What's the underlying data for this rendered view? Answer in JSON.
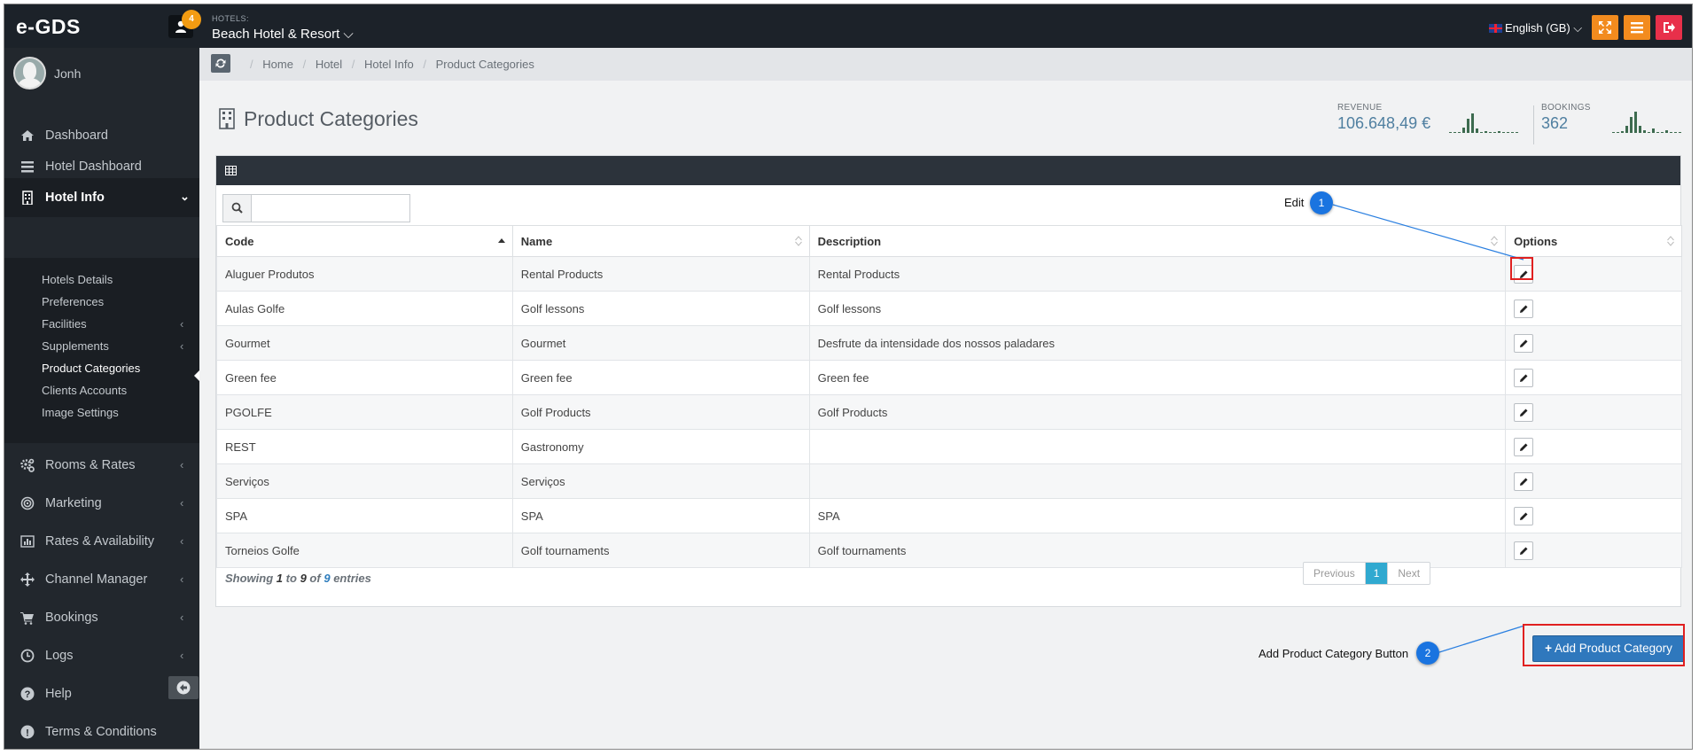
{
  "topbar": {
    "logo": "e-GDS",
    "notification_count": "4",
    "hotel_caption": "HOTELS:",
    "hotel_name": "Beach Hotel & Resort ⌵",
    "language": "English (GB) ⌵"
  },
  "sidebar": {
    "username": "Jonh",
    "items": [
      {
        "label": "Dashboard",
        "icon": "home-icon"
      },
      {
        "label": "Hotel Dashboard",
        "icon": "tasks-icon"
      },
      {
        "label": "Hotel Info",
        "icon": "building-icon"
      },
      {
        "label": "Rooms & Rates",
        "icon": "cogs-icon"
      },
      {
        "label": "Marketing",
        "icon": "bullseye-icon"
      },
      {
        "label": "Rates & Availability",
        "icon": "bar-chart-icon"
      },
      {
        "label": "Channel Manager",
        "icon": "arrows-icon"
      },
      {
        "label": "Bookings",
        "icon": "cart-icon"
      },
      {
        "label": "Logs",
        "icon": "clock-icon"
      },
      {
        "label": "Help",
        "icon": "question-icon"
      },
      {
        "label": "Terms & Conditions",
        "icon": "exclamation-icon"
      }
    ],
    "submenu": [
      {
        "label": "Hotels Details"
      },
      {
        "label": "Preferences"
      },
      {
        "label": "Facilities"
      },
      {
        "label": "Supplements"
      },
      {
        "label": "Product Categories"
      },
      {
        "label": "Clients Accounts"
      },
      {
        "label": "Image Settings"
      }
    ]
  },
  "breadcrumb": [
    "Home",
    "Hotel",
    "Hotel Info",
    "Product Categories"
  ],
  "page": {
    "title": "Product Categories"
  },
  "stats": {
    "revenue_caption": "REVENUE",
    "revenue_value": "106.648,49 €",
    "bookings_caption": "BOOKINGS",
    "bookings_value": "362"
  },
  "table": {
    "search_value": "",
    "columns": [
      "Code",
      "Name",
      "Description",
      "Options"
    ],
    "rows": [
      {
        "code": "Aluguer Produtos",
        "name": "Rental Products",
        "description": "Rental Products"
      },
      {
        "code": "Aulas Golfe",
        "name": "Golf lessons",
        "description": "Golf lessons"
      },
      {
        "code": "Gourmet",
        "name": "Gourmet",
        "description": "Desfrute da intensidade dos nossos paladares"
      },
      {
        "code": "Green fee",
        "name": "Green fee",
        "description": "Green fee"
      },
      {
        "code": "PGOLFE",
        "name": "Golf Products",
        "description": "Golf Products"
      },
      {
        "code": "REST",
        "name": "Gastronomy",
        "description": ""
      },
      {
        "code": "Serviços",
        "name": "Serviços",
        "description": ""
      },
      {
        "code": "SPA",
        "name": "SPA",
        "description": "SPA"
      },
      {
        "code": "Torneios Golfe",
        "name": "Golf tournaments",
        "description": "Golf tournaments"
      }
    ],
    "showing_prefix": "Showing",
    "showing_from": "1",
    "showing_to_word": "to",
    "showing_to": "9",
    "showing_of_word": "of",
    "showing_total": "9",
    "showing_suffix": "entries",
    "pager": {
      "previous": "Previous",
      "current": "1",
      "next": "Next"
    }
  },
  "add_button_label": "Add Product Category",
  "annotations": [
    {
      "label": "Edit",
      "number": "1"
    },
    {
      "label": "Add Product Category Button",
      "number": "2"
    }
  ],
  "colors": {
    "topbar": "#1c2229",
    "sidebar": "#22272d",
    "primary": "#2f78bd",
    "orange": "#f28b1e",
    "danger": "#e8304a",
    "annotation_badge": "#1a74e0",
    "annotation_box": "#e02020",
    "sparkline": "#3d6b4f"
  }
}
